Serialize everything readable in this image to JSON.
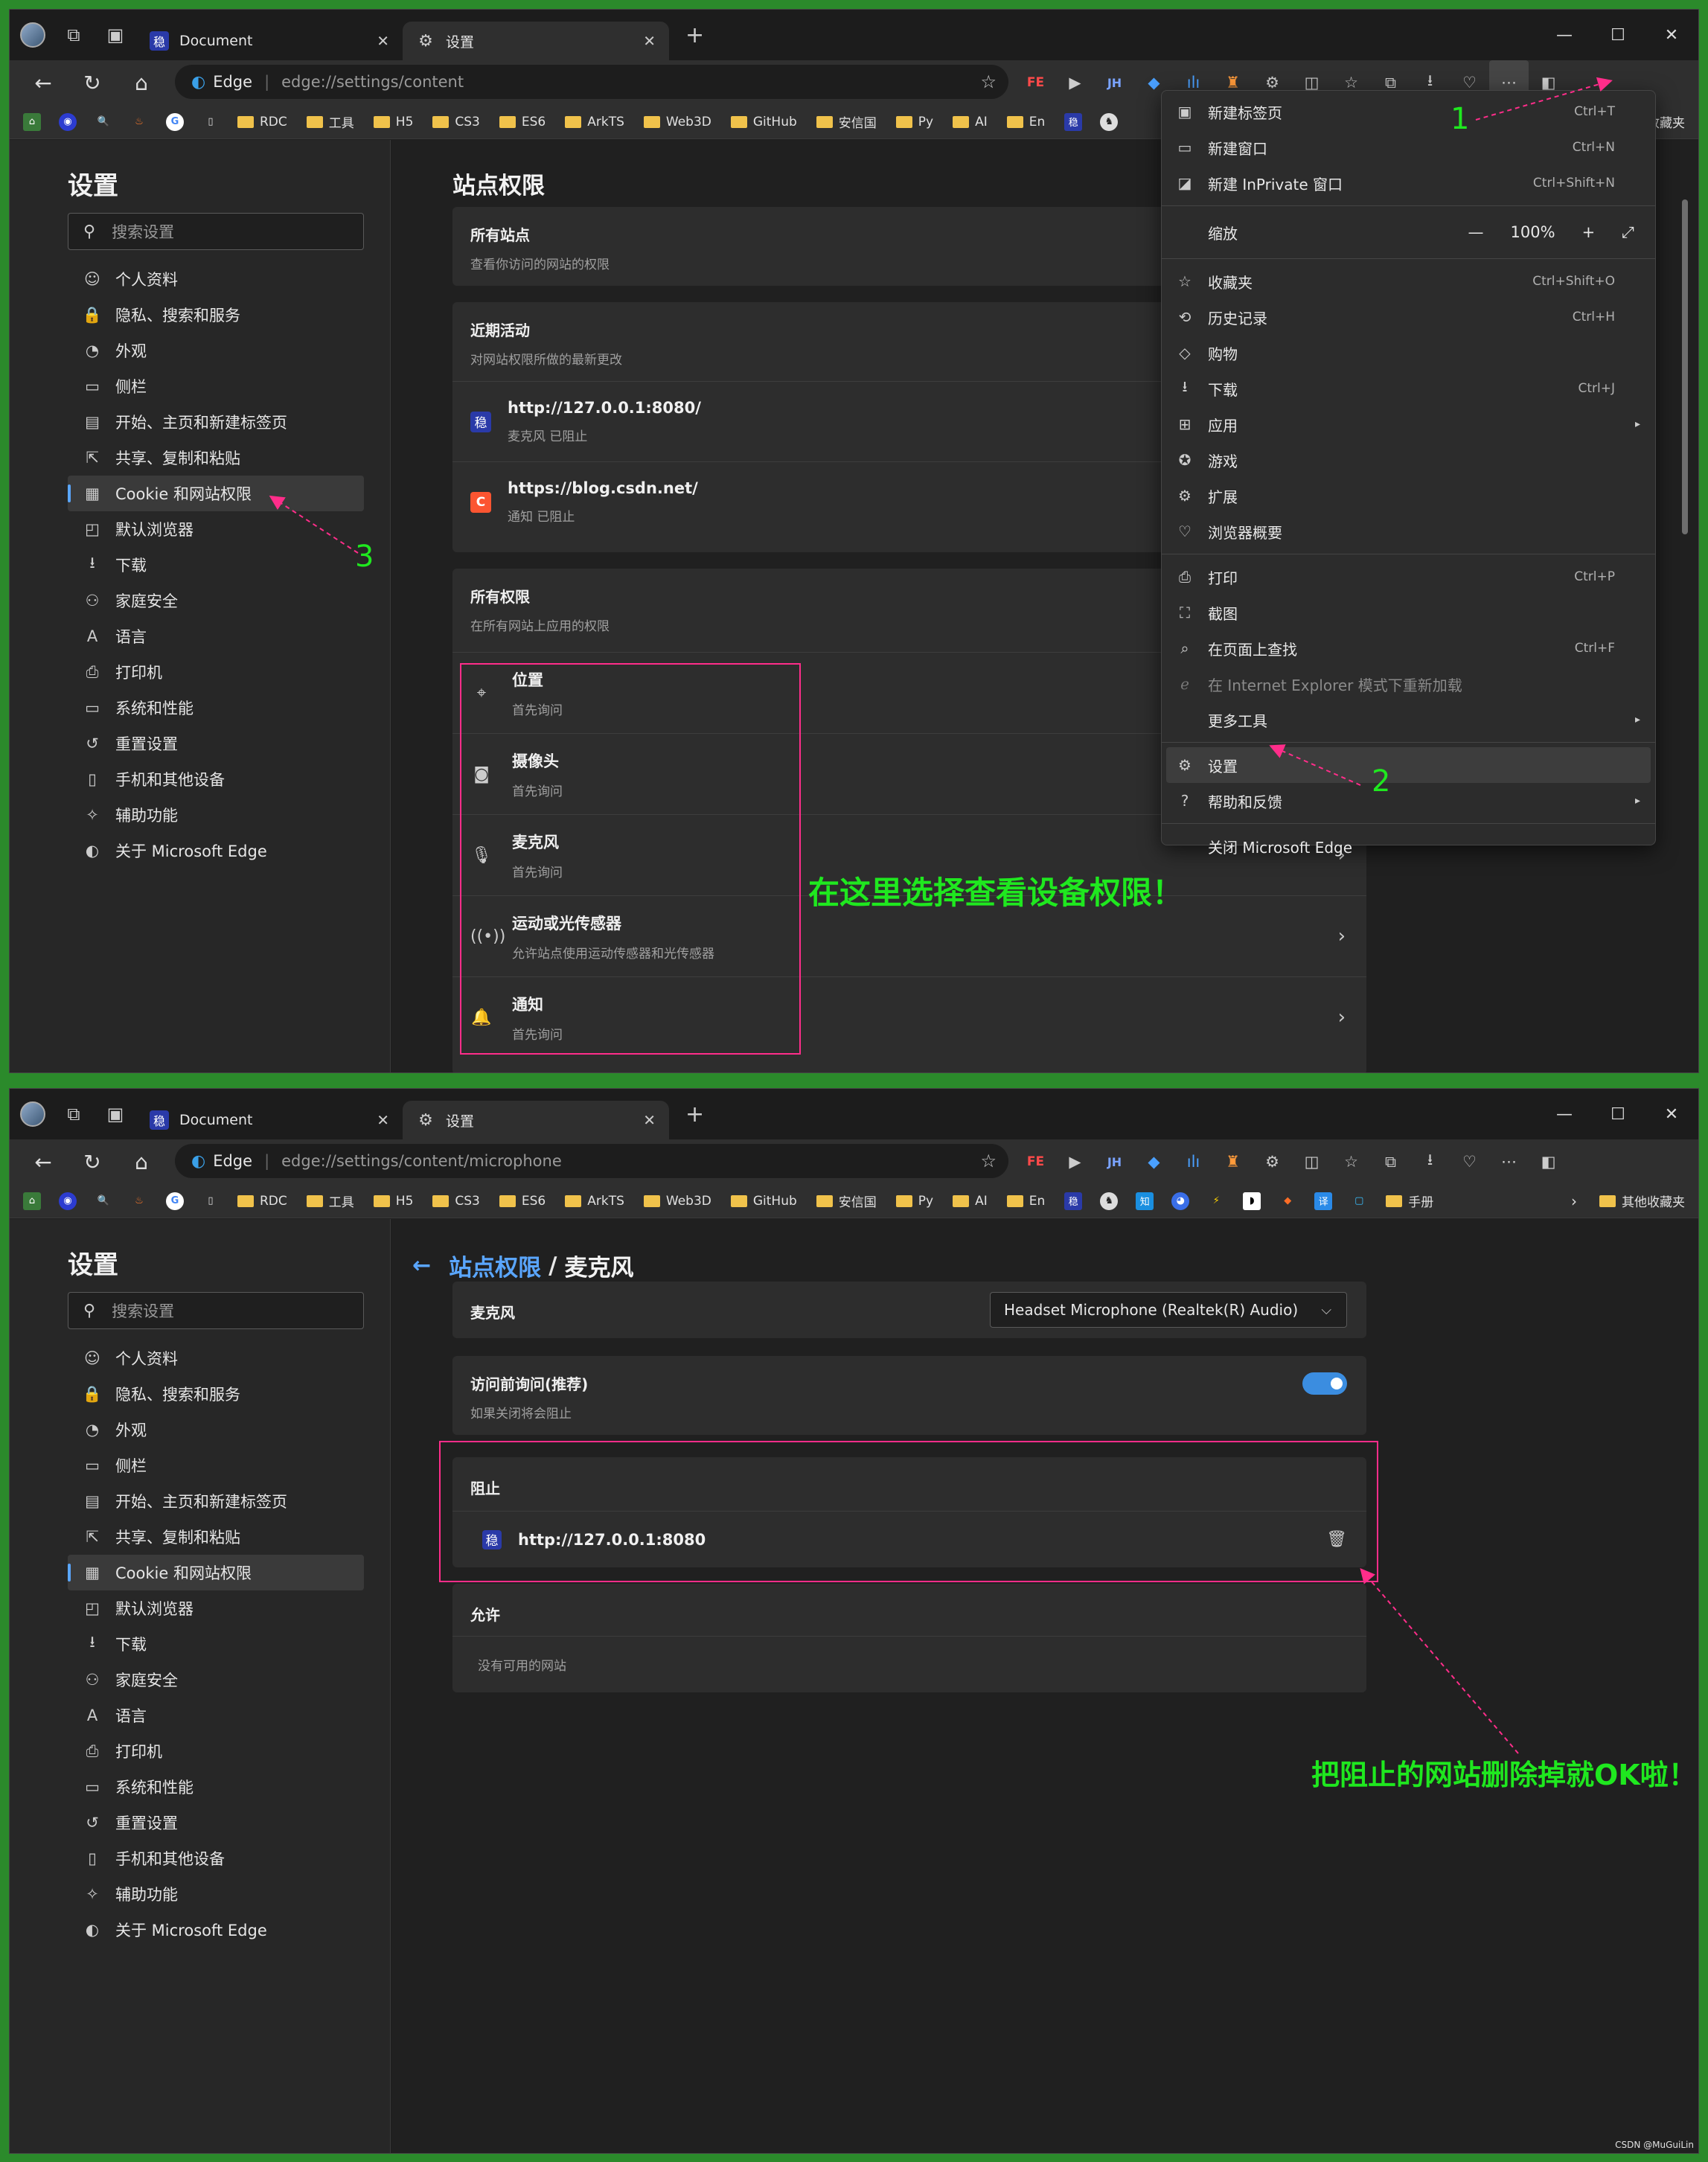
{
  "window": {
    "tabs": [
      {
        "label": "Document",
        "icon": "稳"
      },
      {
        "label": "设置",
        "icon": "gear-icon"
      }
    ],
    "new_tab": "+",
    "controls": [
      "—",
      "☐",
      "✕"
    ]
  },
  "toolbar": {
    "brand": "Edge",
    "url_top": "edge://settings/content",
    "url_bottom": "edge://settings/content/microphone"
  },
  "bookmarks": {
    "folders": [
      "RDC",
      "工具",
      "H5",
      "CS3",
      "ES6",
      "ArkTS",
      "Web3D",
      "GitHub",
      "安信国",
      "Py",
      "AI",
      "En"
    ],
    "extra_folder": "手册",
    "other": "其他收藏夹",
    "other_clipped": "收藏夹"
  },
  "sidebar": {
    "title": "设置",
    "search_placeholder": "搜索设置",
    "items": [
      {
        "label": "个人资料",
        "icon": "profile-icon"
      },
      {
        "label": "隐私、搜索和服务",
        "icon": "lock-icon"
      },
      {
        "label": "外观",
        "icon": "appearance-icon"
      },
      {
        "label": "侧栏",
        "icon": "sidebar-icon"
      },
      {
        "label": "开始、主页和新建标签页",
        "icon": "home-icon"
      },
      {
        "label": "共享、复制和粘贴",
        "icon": "share-icon"
      },
      {
        "label": "Cookie 和网站权限",
        "icon": "cookie-icon"
      },
      {
        "label": "默认浏览器",
        "icon": "browser-icon"
      },
      {
        "label": "下载",
        "icon": "download-icon"
      },
      {
        "label": "家庭安全",
        "icon": "family-icon"
      },
      {
        "label": "语言",
        "icon": "language-icon"
      },
      {
        "label": "打印机",
        "icon": "printer-icon"
      },
      {
        "label": "系统和性能",
        "icon": "system-icon"
      },
      {
        "label": "重置设置",
        "icon": "reset-icon"
      },
      {
        "label": "手机和其他设备",
        "icon": "phone-icon"
      },
      {
        "label": "辅助功能",
        "icon": "accessibility-icon"
      },
      {
        "label": "关于 Microsoft Edge",
        "icon": "edge-icon"
      }
    ],
    "selected_index": 6
  },
  "site_permissions": {
    "title": "站点权限",
    "all_sites": {
      "title": "所有站点",
      "desc": "查看你访问的网站的权限"
    },
    "recent": {
      "title": "近期活动",
      "desc": "对网站权限所做的最新更改",
      "items": [
        {
          "url": "http://127.0.0.1:8080/",
          "status": "麦克风 已阻止",
          "icon": "稳"
        },
        {
          "url": "https://blog.csdn.net/",
          "status": "通知 已阻止",
          "icon": "C"
        }
      ]
    },
    "all_permissions": {
      "title": "所有权限",
      "desc": "在所有网站上应用的权限",
      "items": [
        {
          "label": "位置",
          "desc": "首先询问",
          "icon": "location-icon"
        },
        {
          "label": "摄像头",
          "desc": "首先询问",
          "icon": "camera-icon"
        },
        {
          "label": "麦克风",
          "desc": "首先询问",
          "icon": "microphone-icon"
        },
        {
          "label": "运动或光传感器",
          "desc": "允许站点使用运动传感器和光传感器",
          "icon": "sensor-icon"
        },
        {
          "label": "通知",
          "desc": "首先询问",
          "icon": "bell-icon"
        }
      ]
    }
  },
  "menu": {
    "items": [
      {
        "label": "新建标签页",
        "shortcut": "Ctrl+T",
        "icon": "new-tab-icon"
      },
      {
        "label": "新建窗口",
        "shortcut": "Ctrl+N",
        "icon": "new-window-icon"
      },
      {
        "label": "新建 InPrivate 窗口",
        "shortcut": "Ctrl+Shift+N",
        "icon": "inprivate-icon"
      }
    ],
    "zoom_label": "缩放",
    "zoom_value": "100%",
    "items2": [
      {
        "label": "收藏夹",
        "shortcut": "Ctrl+Shift+O",
        "icon": "favorites-icon"
      },
      {
        "label": "历史记录",
        "shortcut": "Ctrl+H",
        "icon": "history-icon"
      },
      {
        "label": "购物",
        "shortcut": "",
        "icon": "shopping-icon"
      },
      {
        "label": "下载",
        "shortcut": "Ctrl+J",
        "icon": "download-icon"
      },
      {
        "label": "应用",
        "shortcut": "",
        "icon": "apps-icon",
        "submenu": true
      },
      {
        "label": "游戏",
        "shortcut": "",
        "icon": "games-icon"
      },
      {
        "label": "扩展",
        "shortcut": "",
        "icon": "extensions-icon"
      },
      {
        "label": "浏览器概要",
        "shortcut": "",
        "icon": "essentials-icon"
      }
    ],
    "items3": [
      {
        "label": "打印",
        "shortcut": "Ctrl+P",
        "icon": "print-icon"
      },
      {
        "label": "截图",
        "shortcut": "",
        "icon": "screenshot-icon"
      },
      {
        "label": "在页面上查找",
        "shortcut": "Ctrl+F",
        "icon": "find-icon"
      },
      {
        "label": "在 Internet Explorer 模式下重新加载",
        "shortcut": "",
        "icon": "ie-icon",
        "disabled": true
      },
      {
        "label": "更多工具",
        "shortcut": "",
        "icon": "",
        "submenu": true
      }
    ],
    "items4": [
      {
        "label": "设置",
        "shortcut": "",
        "icon": "gear-icon"
      },
      {
        "label": "帮助和反馈",
        "shortcut": "",
        "icon": "help-icon",
        "submenu": true
      }
    ],
    "close_label": "关闭 Microsoft Edge"
  },
  "microphone_page": {
    "breadcrumb_link": "站点权限",
    "breadcrumb_sep": "/",
    "breadcrumb_current": "麦克风",
    "device_label": "麦克风",
    "device_value": "Headset Microphone (Realtek(R) Audio)",
    "ask_title": "访问前询问(推荐)",
    "ask_desc": "如果关闭将会阻止",
    "ask_on": true,
    "block_title": "阻止",
    "blocked_site": "http://127.0.0.1:8080",
    "blocked_icon": "稳",
    "allow_title": "允许",
    "allow_empty": "没有可用的网站"
  },
  "annotations": {
    "select_devices": "在这里选择查看设备权限！",
    "delete_blocked": "把阻止的网站删除掉就OK啦！",
    "n1": "1",
    "n2": "2",
    "n3": "3"
  },
  "watermark": "CSDN @MuGuiLin",
  "colors": {
    "accent": "#5aa6ff",
    "annotation": "#1fe81f",
    "highlight": "#ff2d8a",
    "toggle_on": "#3b8de0"
  }
}
